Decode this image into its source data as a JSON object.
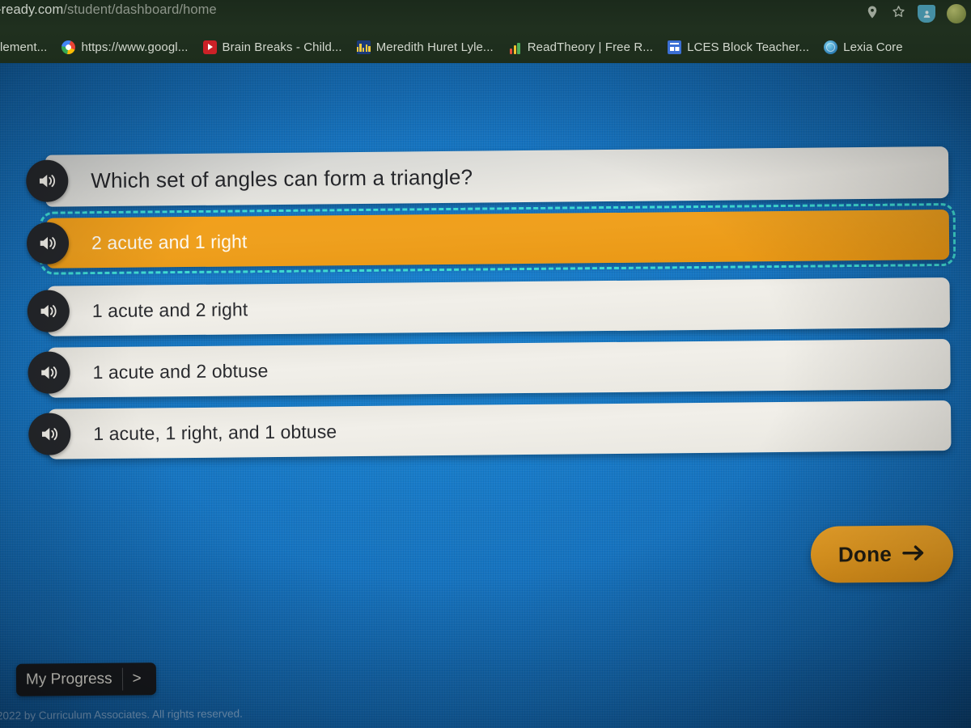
{
  "browser": {
    "url": "-ready.com/student/dashboard/home",
    "url_domain_part": "-ready.com",
    "url_path_part": "/student/dashboard/home",
    "actions": [
      {
        "name": "location-pin-icon",
        "label": "Location"
      },
      {
        "name": "bookmark-star-icon",
        "label": "Bookmark this tab"
      },
      {
        "name": "profile-badge-icon",
        "label": "Profile"
      },
      {
        "name": "avatar",
        "label": "Account avatar"
      }
    ],
    "bookmarks": [
      {
        "label": "lement...",
        "favicon": "none"
      },
      {
        "label": "https://www.googl...",
        "favicon": "google-icon"
      },
      {
        "label": "Brain Breaks - Child...",
        "favicon": "youtube-icon"
      },
      {
        "label": "Meredith Huret Lyle...",
        "favicon": "bar-chart-blue-icon"
      },
      {
        "label": "ReadTheory | Free R...",
        "favicon": "bar-chart-color-icon"
      },
      {
        "label": "LCES Block Teacher...",
        "favicon": "calendar-blue-icon"
      },
      {
        "label": "Lexia Core",
        "favicon": "lexia-globe-icon"
      }
    ]
  },
  "quiz": {
    "question": "Which set of angles can form a triangle?",
    "speaker_icon": "speaker-audio-icon",
    "options": [
      {
        "text": "2 acute and 1 right",
        "selected": true
      },
      {
        "text": "1 acute and 2 right",
        "selected": false
      },
      {
        "text": "1 acute and 2 obtuse",
        "selected": false
      },
      {
        "text": "1 acute, 1 right, and 1 obtuse",
        "selected": false
      }
    ]
  },
  "actions": {
    "done_label": "Done",
    "done_arrow": "→",
    "my_progress_label": "My Progress",
    "my_progress_arrow": ">"
  },
  "footer": {
    "copyright": "2022 by Curriculum Associates. All rights reserved."
  },
  "colors": {
    "page_blue": "#1673bf",
    "selected_orange": "#efa01e",
    "focus_outline_cyan": "#3fd9d1",
    "panel_white": "#eceae4",
    "chrome_dark_green": "#20301f",
    "done_button_orange": "#eb9f22"
  }
}
